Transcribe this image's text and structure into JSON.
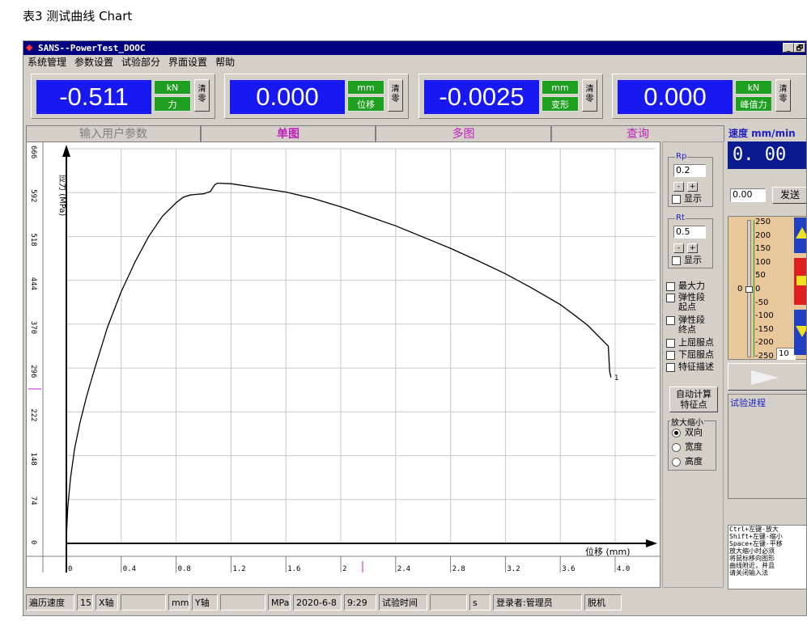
{
  "caption": "表3 测试曲线 Chart",
  "window": {
    "title": "SANS--PowerTest_DOOC",
    "min": "_",
    "restore": "🗗",
    "close": "X"
  },
  "menu": [
    "系统管理",
    "参数设置",
    "试验部分",
    "界面设置",
    "帮助"
  ],
  "displays": [
    {
      "value": "-0.511",
      "unit": "kN",
      "quantity": "力",
      "clear": "清零"
    },
    {
      "value": "0.000",
      "unit": "mm",
      "quantity": "位移",
      "clear": "清零"
    },
    {
      "value": "-0.0025",
      "unit": "mm",
      "quantity": "变形",
      "clear": "清零"
    },
    {
      "value": "0.000",
      "unit": "kN",
      "quantity": "峰值力",
      "clear": "清零"
    }
  ],
  "tabs": [
    "输入用户参数",
    "单图",
    "多图",
    "查询"
  ],
  "chart_data": {
    "type": "line",
    "xlabel": "位移 (mm)",
    "ylabel": "应力 (MPa)",
    "xlim": [
      0,
      4.0
    ],
    "ylim": [
      0,
      666
    ],
    "x_ticks": [
      "0",
      "0.4",
      "0.8",
      "1.2",
      "1.6",
      "2",
      "2.4",
      "2.8",
      "3.2",
      "3.6",
      "4.0"
    ],
    "y_ticks": [
      "0",
      "74",
      "148",
      "222",
      "296",
      "370",
      "444",
      "518",
      "592",
      "666"
    ],
    "grid": true,
    "series": [
      {
        "x": [
          0,
          0.01,
          0.03,
          0.06,
          0.1,
          0.15,
          0.2,
          0.3,
          0.4,
          0.5,
          0.6,
          0.7,
          0.8,
          0.85,
          0.9,
          0.95,
          1.0,
          1.05,
          1.08,
          1.1,
          1.2,
          1.4,
          1.6,
          1.8,
          2.0,
          2.2,
          2.4,
          2.6,
          2.8,
          3.0,
          3.2,
          3.4,
          3.6,
          3.7,
          3.8,
          3.95,
          3.96,
          3.97
        ],
        "y": [
          10,
          60,
          110,
          160,
          205,
          250,
          290,
          365,
          425,
          475,
          518,
          552,
          575,
          584,
          588,
          589,
          590,
          594,
          605,
          608,
          607,
          600,
          593,
          582,
          568,
          552,
          536,
          517,
          498,
          477,
          455,
          430,
          403,
          386,
          368,
          333,
          290,
          280
        ]
      }
    ],
    "end_marker": "1"
  },
  "side": {
    "rp_title": "Rp",
    "rp_value": "0.2",
    "rt_title": "Rt",
    "rt_value": "0.5",
    "minus": "-",
    "plus": "+",
    "show": "显示",
    "checks": [
      "最大力",
      "弹性段\n起点",
      "弹性段\n终点",
      "上屈服点",
      "下屈服点",
      "特征描述"
    ],
    "auto_calc": "自动计算\n特征点",
    "zoom_title": "放大缩小",
    "zoom_options": [
      "双向",
      "宽度",
      "高度"
    ],
    "zoom_selected": 0
  },
  "far": {
    "speed_label": "速度 mm/min",
    "speed_value": "0. 00",
    "speed_input": "0.00",
    "send": "发送",
    "scale": [
      "250",
      "200",
      "150",
      "100",
      "50",
      "0",
      "-50",
      "-100",
      "-150",
      "-200",
      "-250"
    ],
    "slider_value": "0",
    "step_input": "10",
    "progress_title": "试验进程",
    "help_text": "Ctrl+左键-放大\nShift+左键-缩小\nSpace+左键-平移\n放大缩小时必须\n将鼠标移向图形\n曲线附近，并且\n请关闭输入法",
    "colors": {
      "up": "#2040c0",
      "stop": "#e02020",
      "down": "#2040c0"
    }
  },
  "status": {
    "speed_label": "遍历速度",
    "speed_value": "15",
    "x_label": "X轴",
    "x_value": "",
    "x_unit": "mm",
    "y_label": "Y轴",
    "y_value": "",
    "y_unit": "MPa",
    "date": "2020-6-8",
    "time": "9:29",
    "test_time_label": "试验时间",
    "test_time_value": "",
    "test_time_unit": "s",
    "login": "登录者:管理员",
    "offline": "脱机"
  }
}
